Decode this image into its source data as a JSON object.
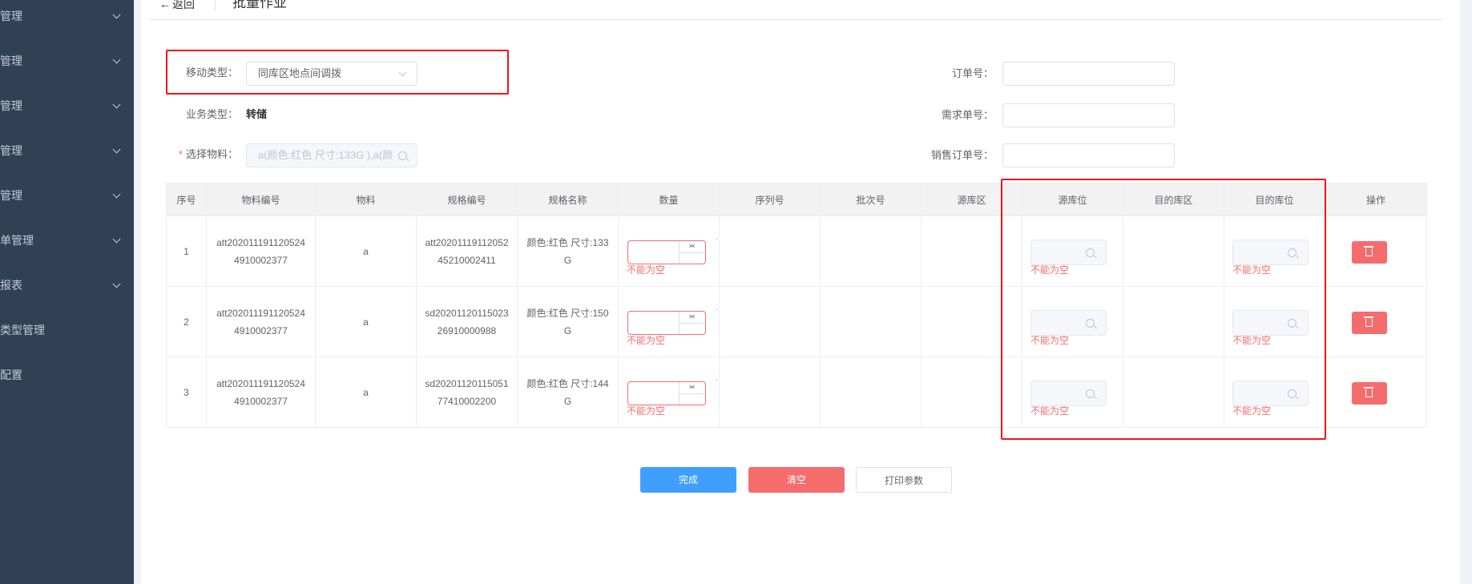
{
  "sidebar": {
    "items": [
      {
        "label": "管理"
      },
      {
        "label": "管理"
      },
      {
        "label": "管理"
      },
      {
        "label": "管理"
      },
      {
        "label": "管理"
      },
      {
        "label": "单管理"
      },
      {
        "label": "报表"
      },
      {
        "label": "类型管理"
      },
      {
        "label": "配置"
      }
    ]
  },
  "header": {
    "back_label": "返回",
    "title": "批量作业"
  },
  "form": {
    "move_type_label": "移动类型：",
    "move_type_value": "同库区地点间调拨",
    "biz_type_label": "业务类型：",
    "biz_type_value": "转储",
    "material_label": "选择物料：",
    "material_value": "a(颜色:红色 尺寸:133G ),a(颜",
    "order_no_label": "订单号：",
    "demand_no_label": "需求单号：",
    "sales_order_label": "销售订单号："
  },
  "table": {
    "headers": [
      "序号",
      "物料编号",
      "物料",
      "规格编号",
      "规格名称",
      "数量",
      "序列号",
      "批次号",
      "源库区",
      "源库位",
      "目的库区",
      "目的库位",
      "操作"
    ],
    "rows": [
      {
        "no": "1",
        "material_code": "att2020111911205244910002377",
        "material": "a",
        "spec_code": "att2020111911205245210002411",
        "spec_name": "颜色:红色 尺寸:133G"
      },
      {
        "no": "2",
        "material_code": "att2020111911205244910002377",
        "material": "a",
        "spec_code": "sd2020112011502326910000988",
        "spec_name": "颜色:红色 尺寸:150G"
      },
      {
        "no": "3",
        "material_code": "att2020111911205244910002377",
        "material": "a",
        "spec_code": "sd2020112011505177410002200",
        "spec_name": "颜色:红色 尺寸:144G"
      }
    ],
    "error_text": "不能为空"
  },
  "buttons": {
    "finish": "完成",
    "clear": "清空",
    "print": "打印参数"
  },
  "colors": {
    "sidebar_bg": "#304156",
    "primary": "#409eff",
    "danger": "#f56c6c",
    "highlight_border": "#f0141c"
  }
}
